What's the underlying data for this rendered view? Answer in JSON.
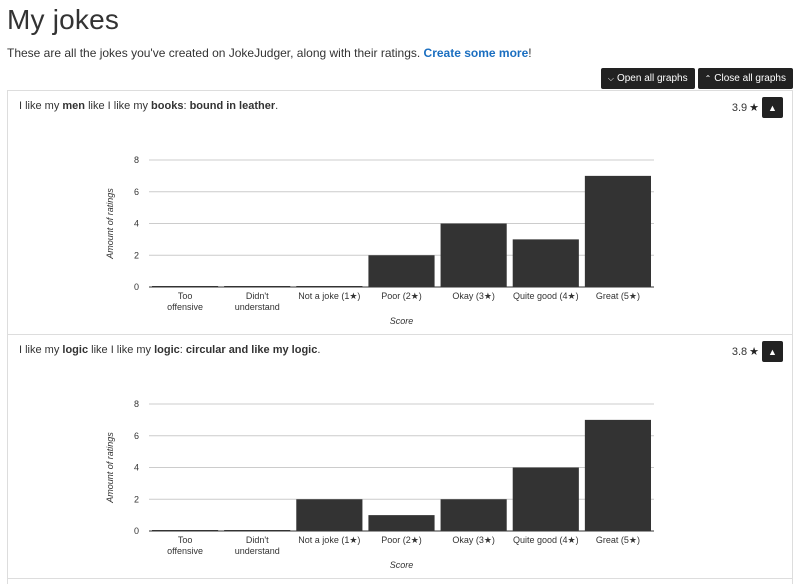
{
  "page": {
    "title": "My jokes",
    "intro_prefix": "These are all the jokes you've created on JokeJudger, along with their ratings. ",
    "intro_link": "Create some more",
    "intro_suffix": "!"
  },
  "toolbar": {
    "open_all": "Open all graphs",
    "close_all": "Close all graphs"
  },
  "jokes": [
    {
      "text_parts": [
        {
          "t": "I like my ",
          "b": false
        },
        {
          "t": "men",
          "b": true
        },
        {
          "t": " like I like my ",
          "b": false
        },
        {
          "t": "books",
          "b": true
        },
        {
          "t": ": ",
          "b": false
        },
        {
          "t": "bound in leather",
          "b": true
        },
        {
          "t": ".",
          "b": false
        }
      ],
      "rating": "3.9"
    },
    {
      "text_parts": [
        {
          "t": "I like my ",
          "b": false
        },
        {
          "t": "logic",
          "b": true
        },
        {
          "t": " like I like my ",
          "b": false
        },
        {
          "t": "logic",
          "b": true
        },
        {
          "t": ": ",
          "b": false
        },
        {
          "t": "circular and like my logic",
          "b": true
        },
        {
          "t": ".",
          "b": false
        }
      ],
      "rating": "3.8"
    }
  ],
  "chart_data": [
    {
      "type": "bar",
      "categories": [
        "Too offensive",
        "Didn't understand",
        "Not a joke (1★)",
        "Poor (2★)",
        "Okay (3★)",
        "Quite good (4★)",
        "Great (5★)"
      ],
      "values": [
        0,
        0,
        0,
        2,
        4,
        3,
        7
      ],
      "xlabel": "Score",
      "ylabel": "Amount of ratings",
      "ylim": [
        0,
        8
      ],
      "yticks": [
        0,
        2,
        4,
        6,
        8
      ],
      "grid": true,
      "bar_color": "#333333"
    },
    {
      "type": "bar",
      "categories": [
        "Too offensive",
        "Didn't understand",
        "Not a joke (1★)",
        "Poor (2★)",
        "Okay (3★)",
        "Quite good (4★)",
        "Great (5★)"
      ],
      "values": [
        0,
        0,
        2,
        1,
        2,
        4,
        7
      ],
      "xlabel": "Score",
      "ylabel": "Amount of ratings",
      "ylim": [
        0,
        8
      ],
      "yticks": [
        0,
        2,
        4,
        6,
        8
      ],
      "grid": true,
      "bar_color": "#333333"
    }
  ]
}
